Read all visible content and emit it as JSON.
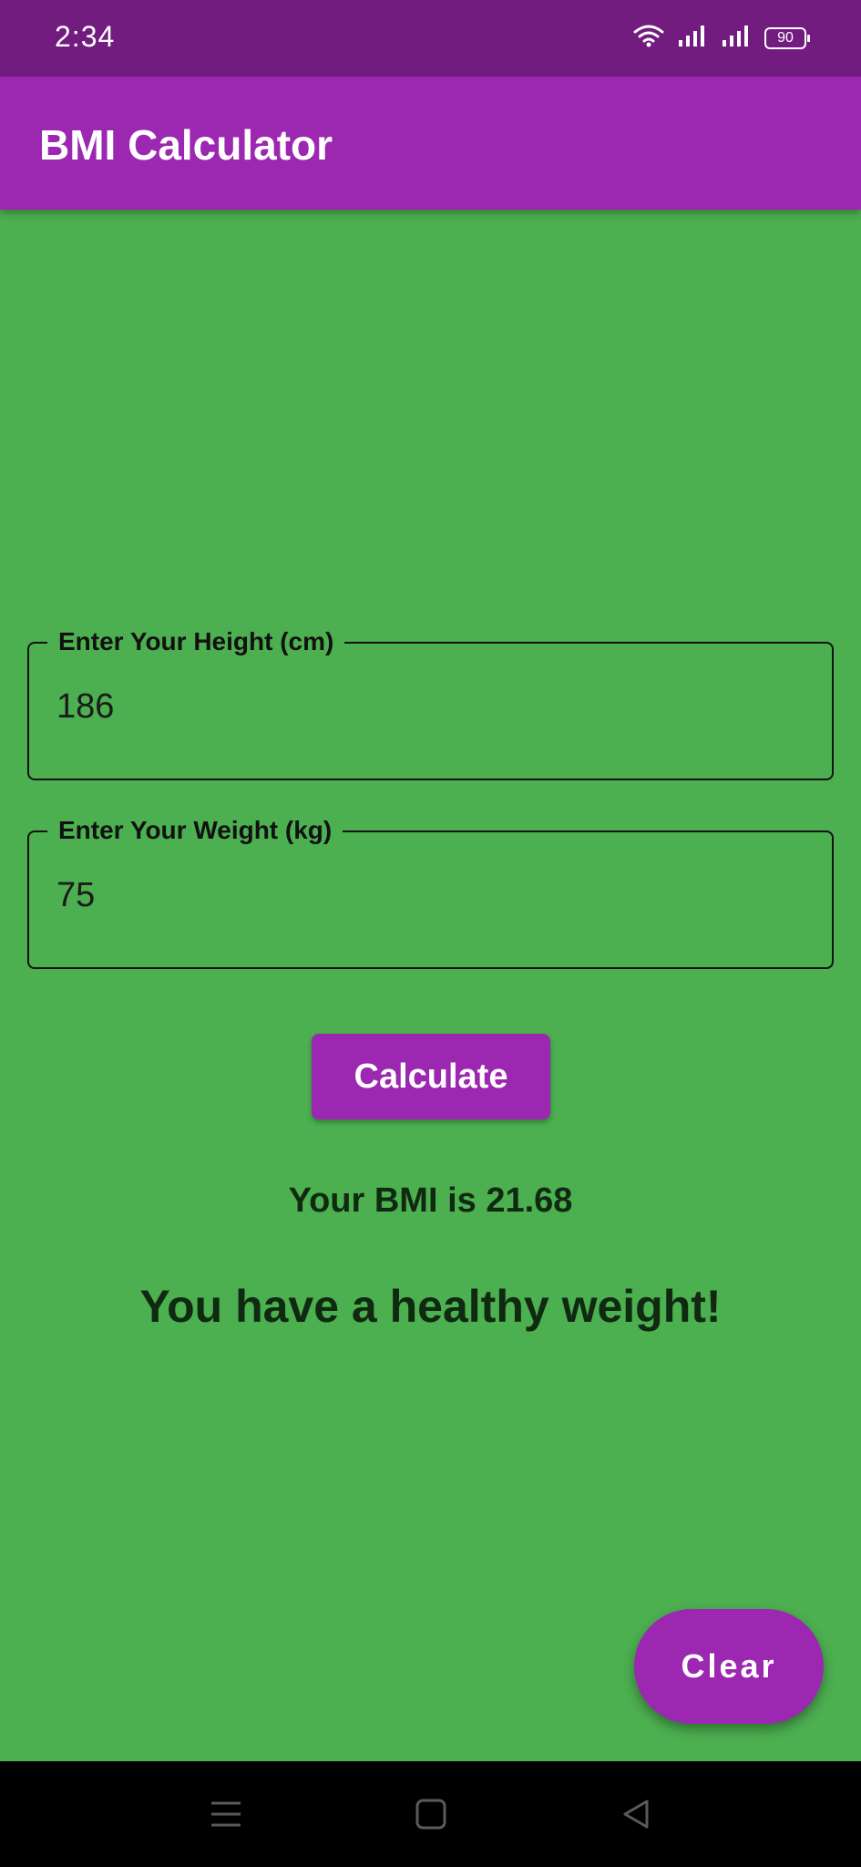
{
  "status_bar": {
    "time": "2:34",
    "battery_level": "90",
    "icons": [
      "wifi-icon",
      "signal-icon",
      "signal-icon",
      "battery-icon"
    ]
  },
  "app_bar": {
    "title": "BMI Calculator",
    "color": "#9c27b0"
  },
  "form": {
    "height_label": "Enter Your Height (cm)",
    "height_value": "186",
    "weight_label": "Enter Your Weight (kg)",
    "weight_value": "75",
    "calculate_label": "Calculate"
  },
  "result": {
    "bmi_text": "Your BMI is 21.68",
    "message": "You have a healthy weight!"
  },
  "fab": {
    "clear_label": "Clear"
  },
  "nav_bar": {
    "icons": [
      "menu-icon",
      "home-icon",
      "back-icon"
    ]
  },
  "colors": {
    "background": "#4caf50",
    "accent": "#9c27b0",
    "status_bar": "#731c80"
  }
}
